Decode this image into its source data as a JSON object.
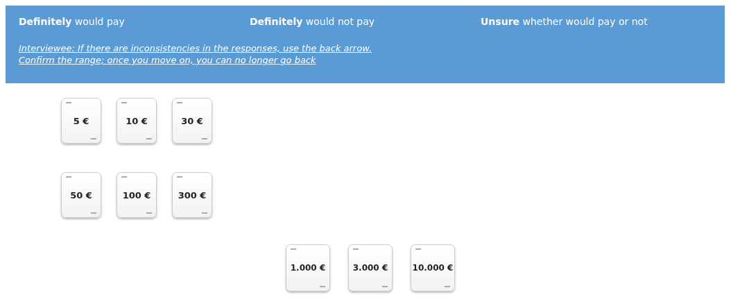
{
  "header": {
    "options": [
      "**Definitely** would pay",
      "**Definitely** would not pay",
      "**Unsure** whether would pay or not"
    ],
    "instructions": [
      "Interviewee: If there are inconsistencies in the responses, use the back arrow.",
      "Confirm the range; once you move on, you can no longer go back"
    ]
  },
  "card_rows": [
    {
      "cards": [
        {
          "amount": "5 €"
        },
        {
          "amount": "10 €"
        },
        {
          "amount": "30 €"
        }
      ]
    },
    {
      "cards": [
        {
          "amount": "50 €"
        },
        {
          "amount": "100 €"
        },
        {
          "amount": "300 €"
        }
      ]
    },
    {
      "cards": [
        {
          "amount": "1.000 €"
        },
        {
          "amount": "3.000 €"
        },
        {
          "amount": "10.000 €"
        }
      ]
    }
  ]
}
